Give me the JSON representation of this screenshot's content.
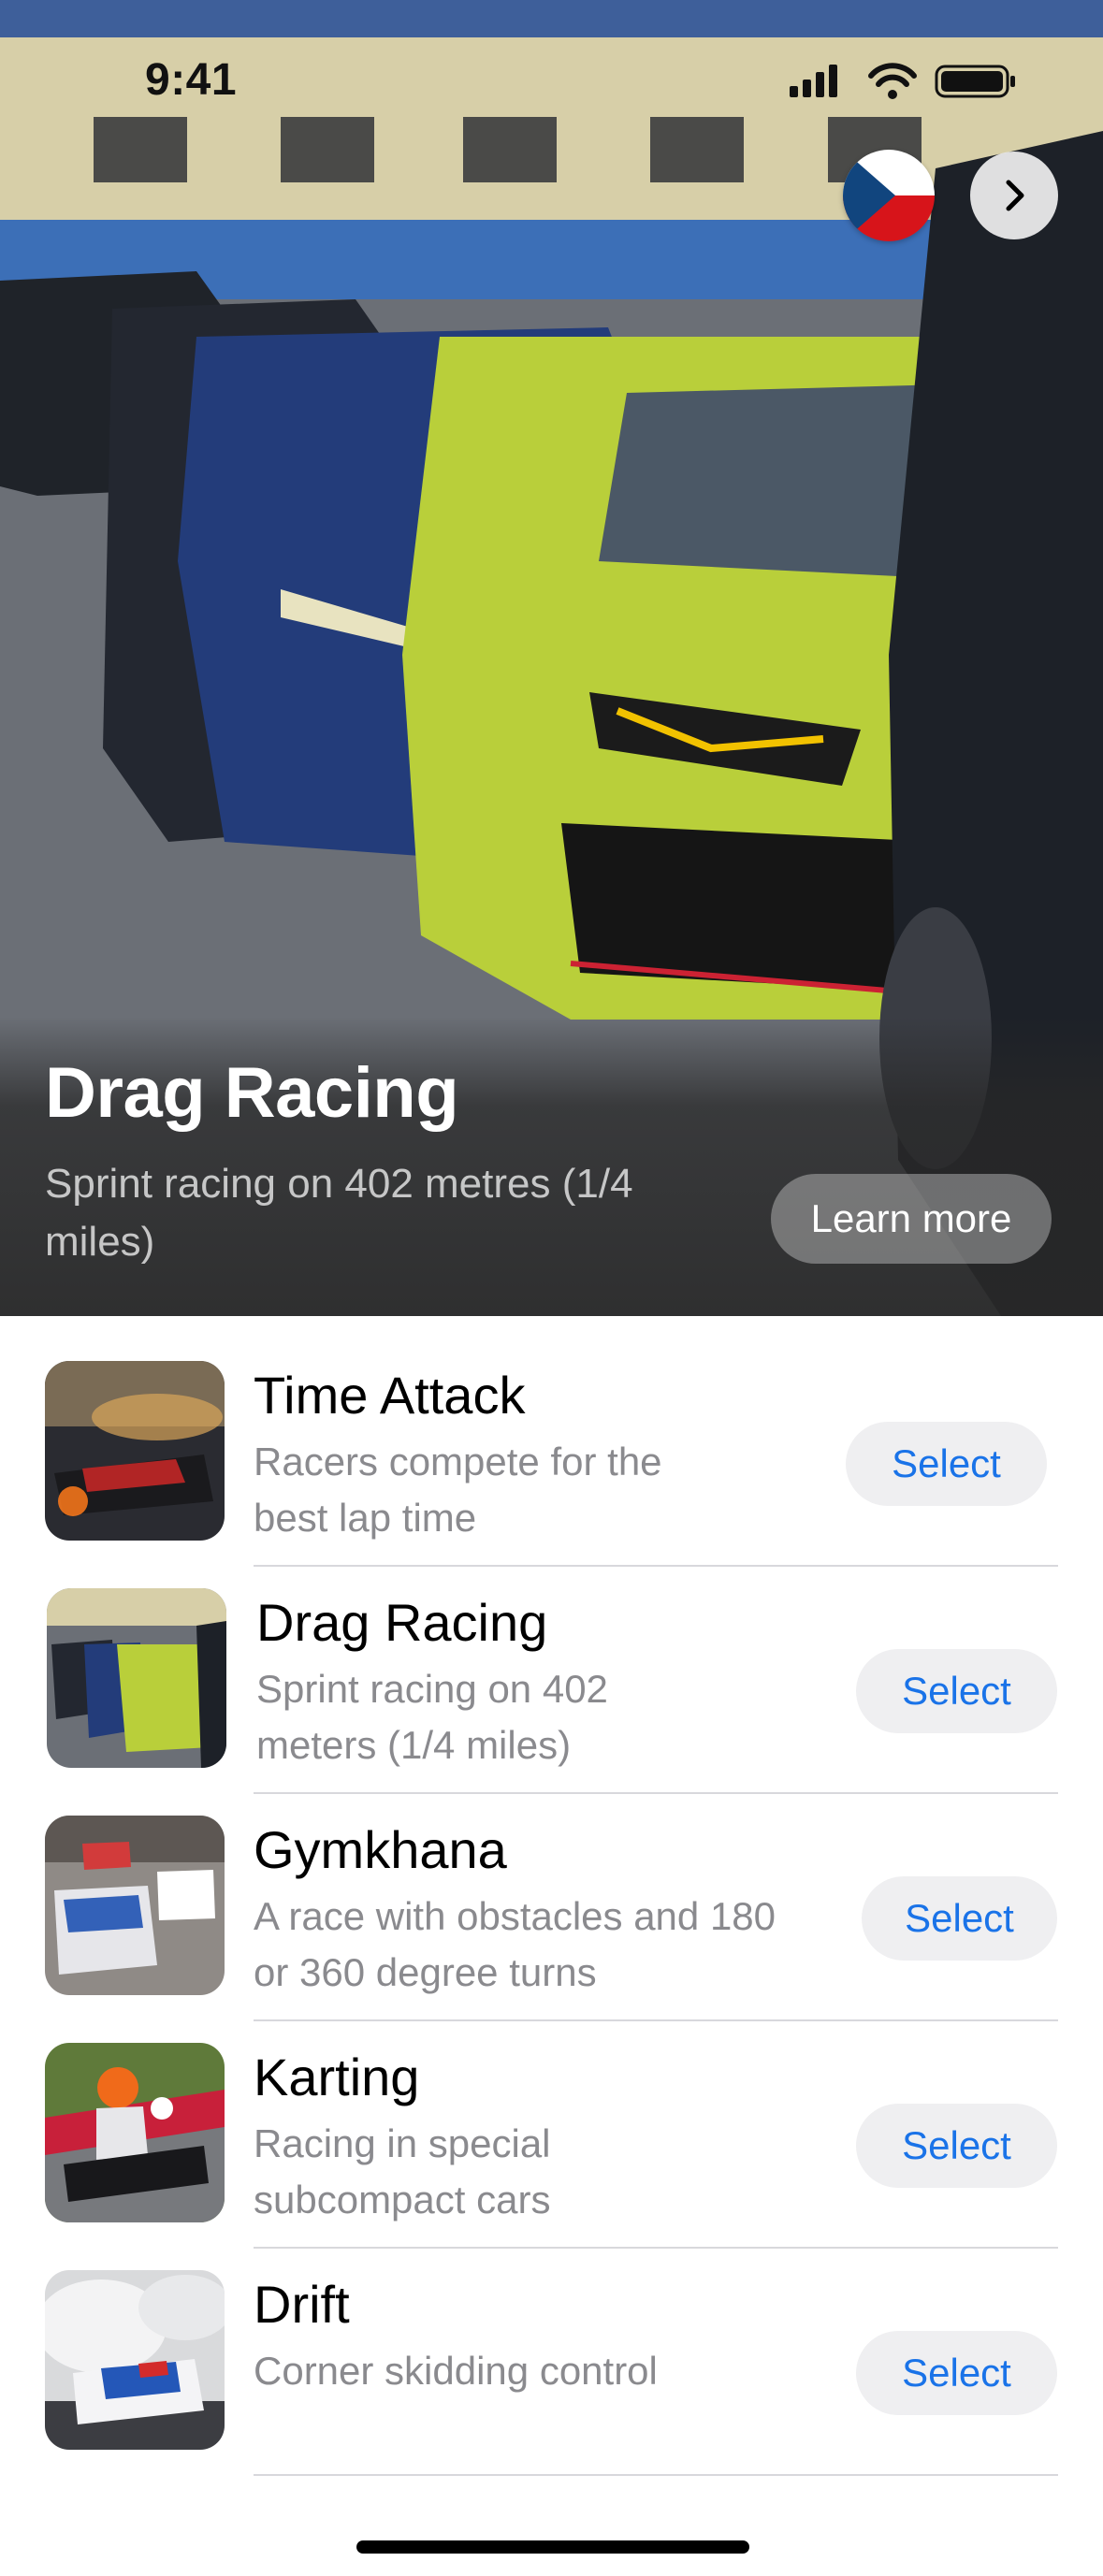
{
  "status_bar": {
    "time": "9:41"
  },
  "hero": {
    "title": "Drag Racing",
    "subtitle": "Sprint racing on 402 metres (1/4 miles)",
    "learn_more_label": "Learn more",
    "language_flag": "czech-flag-icon",
    "next_icon": "chevron-right-icon"
  },
  "list": {
    "items": [
      {
        "title": "Time Attack",
        "description": "Racers compete for the best lap time",
        "select_label": "Select",
        "thumbnail": "time-attack-thumbnail"
      },
      {
        "title": "Drag Racing",
        "description": "Sprint racing on 402 meters (1/4 miles)",
        "select_label": "Select",
        "thumbnail": "drag-racing-thumbnail"
      },
      {
        "title": "Gymkhana",
        "description": "A race with obstacles and 180 or 360 degree turns",
        "select_label": "Select",
        "thumbnail": "gymkhana-thumbnail"
      },
      {
        "title": "Karting",
        "description": "Racing in special subcompact cars",
        "select_label": "Select",
        "thumbnail": "karting-thumbnail"
      },
      {
        "title": "Drift",
        "description": "Corner skidding control",
        "select_label": "Select",
        "thumbnail": "drift-thumbnail"
      }
    ]
  },
  "colors": {
    "accent": "#1a73e8",
    "select_bg": "#efeff1",
    "secondary_text": "#8a8a8e"
  }
}
